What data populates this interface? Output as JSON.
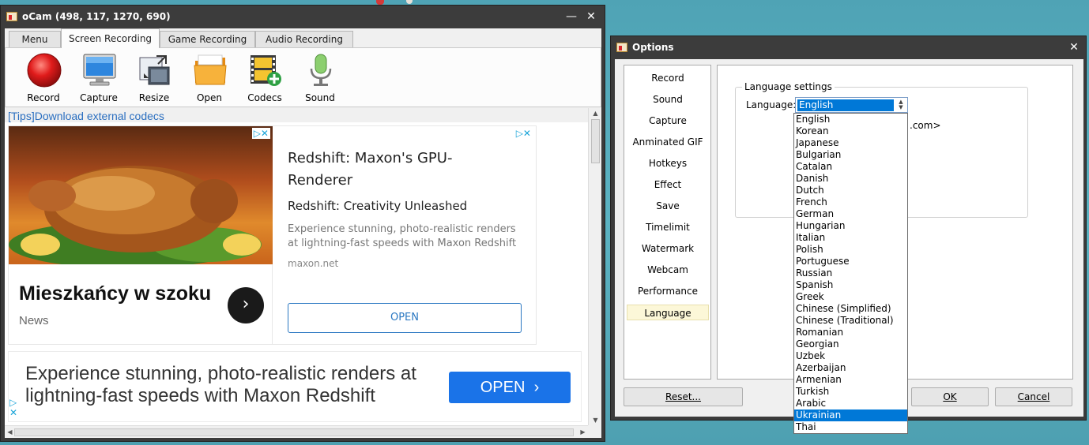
{
  "ocam": {
    "title": "oCam (498, 117, 1270, 690)",
    "tabs": [
      "Menu",
      "Screen Recording",
      "Game Recording",
      "Audio Recording"
    ],
    "active_tab": "Screen Recording",
    "toolbar": {
      "record": "Record",
      "capture": "Capture",
      "resize": "Resize",
      "open": "Open",
      "codecs": "Codecs",
      "sound": "Sound"
    },
    "tips_link": "[Tips]Download external codecs",
    "ads": {
      "left": {
        "headline": "Mieszkańcy w szoku",
        "source": "News"
      },
      "right": {
        "title": "Redshift: Maxon's GPU-Renderer",
        "subtitle": "Redshift: Creativity Unleashed",
        "description": "Experience stunning, photo-realistic renders at lightning-fast speeds with Maxon Redshift",
        "domain": "maxon.net",
        "button": "OPEN"
      },
      "banner": {
        "text": "Experience stunning, photo-realistic renders at lightning-fast speeds with Maxon Redshift",
        "button": "OPEN"
      }
    }
  },
  "options": {
    "title": "Options",
    "nav": [
      "Record",
      "Sound",
      "Capture",
      "Anminated GIF",
      "Hotkeys",
      "Effect",
      "Save",
      "Timelimit",
      "Watermark",
      "Webcam",
      "Performance",
      "Language"
    ],
    "selected_nav": "Language",
    "group_title": "Language settings",
    "language_label": "Language:",
    "language_value": "English",
    "credit_suffix": ".com>",
    "buttons": {
      "reset": "Reset...",
      "ok": "OK",
      "cancel": "Cancel"
    },
    "languages": [
      "English",
      "Korean",
      "Japanese",
      "Bulgarian",
      "Catalan",
      "Danish",
      "Dutch",
      "French",
      "German",
      "Hungarian",
      "Italian",
      "Polish",
      "Portuguese",
      "Russian",
      "Spanish",
      "Greek",
      "Chinese (Simplified)",
      "Chinese (Traditional)",
      "Romanian",
      "Georgian",
      "Uzbek",
      "Azerbaijan",
      "Armenian",
      "Turkish",
      "Arabic",
      "Ukrainian",
      "Thai"
    ],
    "highlighted_language": "Ukrainian"
  },
  "colors": {
    "accent": "#0078d7",
    "titlebar": "#3c3c3c",
    "selected_nav": "#fcf7d8",
    "ad_button": "#1a73e8"
  }
}
